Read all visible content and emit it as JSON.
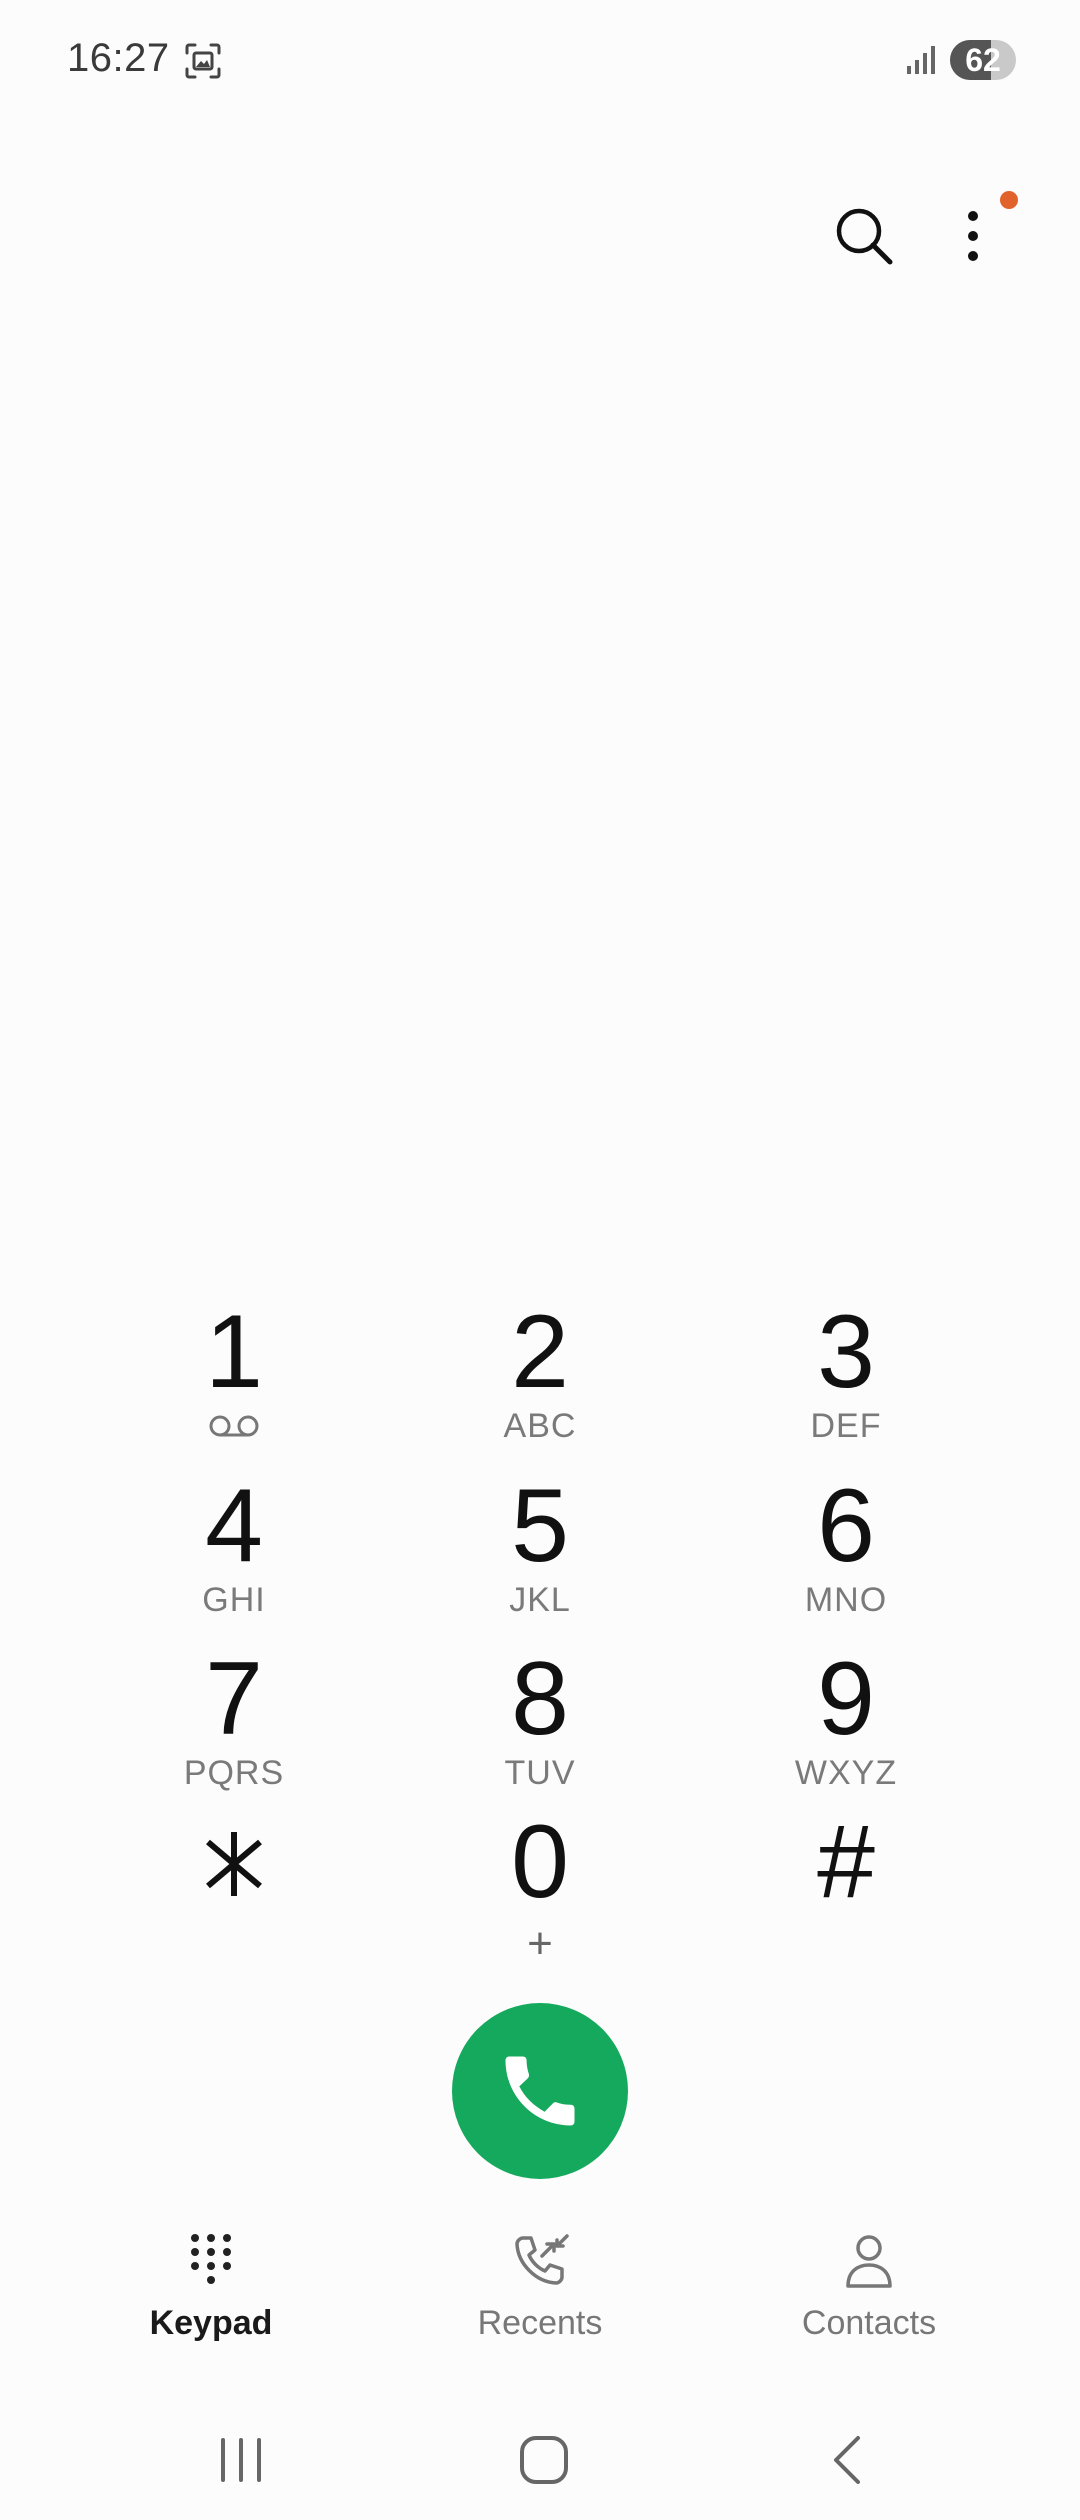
{
  "status_bar": {
    "time": "16:27",
    "battery_level": "62",
    "battery_percent": 62,
    "icons": [
      "screenshot-icon",
      "signal-icon",
      "battery-icon"
    ]
  },
  "top_actions": {
    "search_icon": "search-icon",
    "more_icon": "more-vertical-icon",
    "notification_dot_color": "#e2622c"
  },
  "keypad": {
    "keys": [
      {
        "digit": "1",
        "letters": "",
        "sub_icon": "voicemail-icon"
      },
      {
        "digit": "2",
        "letters": "ABC"
      },
      {
        "digit": "3",
        "letters": "DEF"
      },
      {
        "digit": "4",
        "letters": "GHI"
      },
      {
        "digit": "5",
        "letters": "JKL"
      },
      {
        "digit": "6",
        "letters": "MNO"
      },
      {
        "digit": "7",
        "letters": "PQRS"
      },
      {
        "digit": "8",
        "letters": "TUV"
      },
      {
        "digit": "9",
        "letters": "WXYZ"
      },
      {
        "digit": "",
        "letters": "",
        "icon": "asterisk-icon"
      },
      {
        "digit": "0",
        "letters": "+"
      },
      {
        "digit": "#",
        "letters": ""
      }
    ]
  },
  "call_button": {
    "icon": "phone-icon",
    "color": "#14a95c"
  },
  "bottom_nav": {
    "items": [
      {
        "label": "Keypad",
        "icon": "keypad-icon",
        "active": true
      },
      {
        "label": "Recents",
        "icon": "recents-icon",
        "active": false
      },
      {
        "label": "Contacts",
        "icon": "contacts-icon",
        "active": false
      }
    ]
  },
  "system_nav": {
    "buttons": [
      "recent-apps-icon",
      "home-icon",
      "back-icon"
    ]
  }
}
